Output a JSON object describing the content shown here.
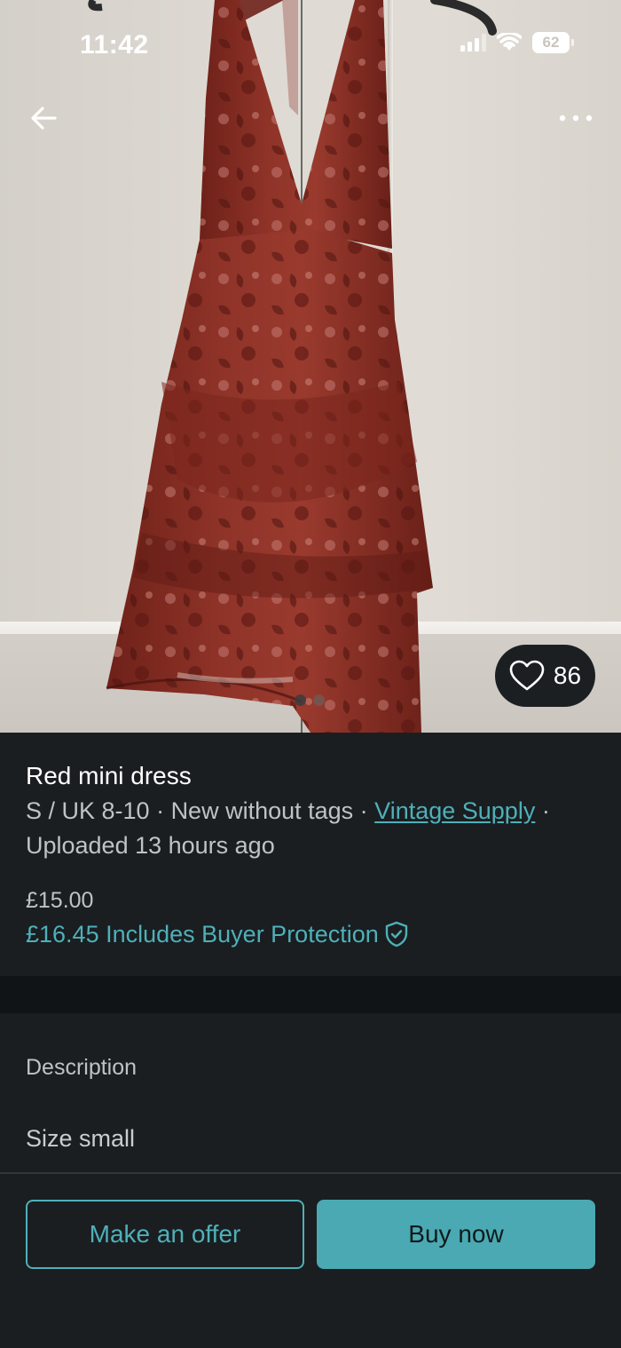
{
  "status_bar": {
    "time": "11:42",
    "battery": "62",
    "icons": [
      "signal-icon",
      "wifi-icon",
      "battery-icon"
    ]
  },
  "nav": {
    "back_icon": "arrow-left-icon",
    "more_icon": "more-horizontal-icon"
  },
  "photo": {
    "subject": "red-floral-halter-dress",
    "like_icon": "heart-icon",
    "like_count": "86",
    "active_image": 1,
    "image_count": 2
  },
  "item": {
    "title": "Red mini dress",
    "size": "S / UK 8-10",
    "separator": " · ",
    "condition": "New without tags",
    "seller": "Vintage Supply",
    "uploaded": "Uploaded 13 hours ago",
    "price": "£15.00",
    "protection_price": "£16.45 Includes Buyer Protection",
    "protection_icon": "shield-check-icon"
  },
  "description": {
    "label": "Description",
    "text": "Size small"
  },
  "actions": {
    "offer_label": "Make an offer",
    "buy_label": "Buy now"
  },
  "colors": {
    "accent": "#4fb0b8",
    "background": "#1a1e21",
    "separator": "#111416",
    "dress": "#8a2e24"
  }
}
